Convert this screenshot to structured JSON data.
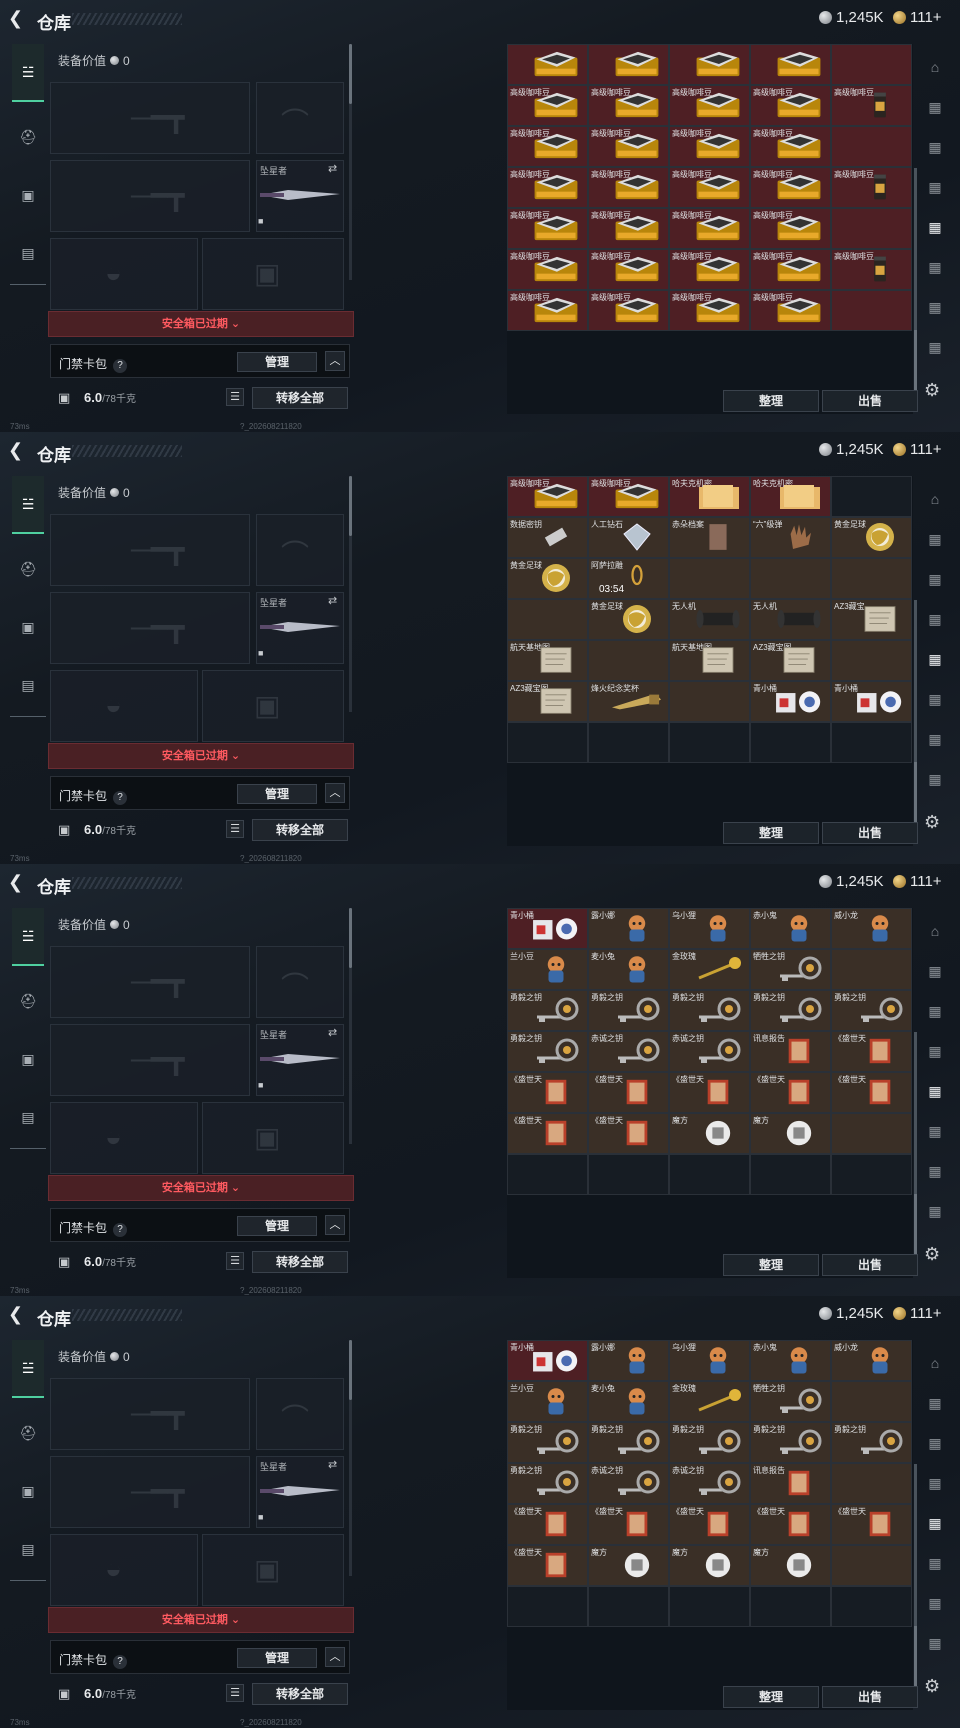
{
  "header": {
    "title": "仓库",
    "silver": "1,245K",
    "gold": "111+"
  },
  "left": {
    "equip_value_label": "装备价值",
    "equip_value": "0",
    "knife_label": "坠星者",
    "warning": "安全箱已过期",
    "keybag_label": "门禁卡包",
    "manage_label": "管理",
    "weight": "6.0",
    "weight_max": "/78千克",
    "move_all_label": "转移全部"
  },
  "buttons": {
    "sort": "整理",
    "sell": "出售"
  },
  "footer": {
    "ping": "73ms",
    "version": "?_202608211820"
  },
  "screens": [
    {
      "cells": [
        {
          "name": "",
          "c": "red",
          "icon": "coffee-bag"
        },
        {
          "name": "",
          "c": "red",
          "icon": "coffee-bag"
        },
        {
          "name": "",
          "c": "red",
          "icon": "coffee-bag"
        },
        {
          "name": "",
          "c": "red",
          "icon": "coffee-bag"
        },
        {
          "name": "",
          "c": "red",
          "icon": "empty"
        },
        {
          "name": "高级咖啡豆",
          "c": "red",
          "icon": "coffee-bag"
        },
        {
          "name": "高级咖啡豆",
          "c": "red",
          "icon": "coffee-bag"
        },
        {
          "name": "高级咖啡豆",
          "c": "red",
          "icon": "coffee-bag"
        },
        {
          "name": "高级咖啡豆",
          "c": "red",
          "icon": "coffee-bag"
        },
        {
          "name": "高级咖啡豆",
          "c": "red",
          "icon": "coffee-tall"
        },
        {
          "name": "高级咖啡豆",
          "c": "red",
          "icon": "coffee-bag"
        },
        {
          "name": "高级咖啡豆",
          "c": "red",
          "icon": "coffee-bag"
        },
        {
          "name": "高级咖啡豆",
          "c": "red",
          "icon": "coffee-bag"
        },
        {
          "name": "高级咖啡豆",
          "c": "red",
          "icon": "coffee-bag"
        },
        {
          "name": "",
          "c": "red",
          "icon": "empty"
        },
        {
          "name": "高级咖啡豆",
          "c": "red",
          "icon": "coffee-bag"
        },
        {
          "name": "高级咖啡豆",
          "c": "red",
          "icon": "coffee-bag"
        },
        {
          "name": "高级咖啡豆",
          "c": "red",
          "icon": "coffee-bag"
        },
        {
          "name": "高级咖啡豆",
          "c": "red",
          "icon": "coffee-bag"
        },
        {
          "name": "高级咖啡豆",
          "c": "red",
          "icon": "coffee-tall"
        },
        {
          "name": "高级咖啡豆",
          "c": "red",
          "icon": "coffee-bag"
        },
        {
          "name": "高级咖啡豆",
          "c": "red",
          "icon": "coffee-bag"
        },
        {
          "name": "高级咖啡豆",
          "c": "red",
          "icon": "coffee-bag"
        },
        {
          "name": "高级咖啡豆",
          "c": "red",
          "icon": "coffee-bag"
        },
        {
          "name": "",
          "c": "red",
          "icon": "empty"
        },
        {
          "name": "高级咖啡豆",
          "c": "red",
          "icon": "coffee-bag"
        },
        {
          "name": "高级咖啡豆",
          "c": "red",
          "icon": "coffee-bag"
        },
        {
          "name": "高级咖啡豆",
          "c": "red",
          "icon": "coffee-bag"
        },
        {
          "name": "高级咖啡豆",
          "c": "red",
          "icon": "coffee-bag"
        },
        {
          "name": "高级咖啡豆",
          "c": "red",
          "icon": "coffee-tall"
        },
        {
          "name": "高级咖啡豆",
          "c": "red",
          "icon": "coffee-bag"
        },
        {
          "name": "高级咖啡豆",
          "c": "red",
          "icon": "coffee-bag"
        },
        {
          "name": "高级咖啡豆",
          "c": "red",
          "icon": "coffee-bag"
        },
        {
          "name": "高级咖啡豆",
          "c": "red",
          "icon": "coffee-bag"
        },
        {
          "name": "",
          "c": "red",
          "icon": "empty"
        }
      ]
    },
    {
      "cells": [
        {
          "name": "高级咖啡豆",
          "c": "red",
          "icon": "coffee-bag"
        },
        {
          "name": "高级咖啡豆",
          "c": "red",
          "icon": "coffee-bag"
        },
        {
          "name": "哈夫克机密",
          "c": "red",
          "icon": "folder"
        },
        {
          "name": "哈夫克机密",
          "c": "red",
          "icon": "folder"
        },
        {
          "name": "",
          "c": "empty",
          "icon": "empty"
        },
        {
          "name": "数据密钥",
          "c": "brown",
          "icon": "chip"
        },
        {
          "name": "人工钻石",
          "c": "brown",
          "icon": "diamond"
        },
        {
          "name": "赤朵档案",
          "c": "brown",
          "icon": "doc"
        },
        {
          "name": "“六”级弹",
          "c": "brown",
          "icon": "hand"
        },
        {
          "name": "黄金足球",
          "c": "brown",
          "icon": "ball"
        },
        {
          "name": "黄金足球",
          "c": "brown",
          "icon": "ball"
        },
        {
          "name": "阿萨拉雕",
          "c": "brown",
          "icon": "statue"
        },
        {
          "name": "",
          "c": "brown",
          "icon": "empty"
        },
        {
          "name": "",
          "c": "brown",
          "icon": "empty"
        },
        {
          "name": "",
          "c": "brown",
          "icon": "empty"
        },
        {
          "name": "",
          "c": "brown",
          "icon": "empty"
        },
        {
          "name": "黄金足球",
          "c": "brown",
          "icon": "ball"
        },
        {
          "name": "无人机",
          "c": "brown",
          "icon": "drum"
        },
        {
          "name": "无人机",
          "c": "brown",
          "icon": "drum"
        },
        {
          "name": "AZ3藏宝",
          "c": "brown",
          "icon": "map"
        },
        {
          "name": "航天基地图",
          "c": "brown",
          "icon": "map"
        },
        {
          "name": "",
          "c": "brown",
          "icon": "empty"
        },
        {
          "name": "航天基地图",
          "c": "brown",
          "icon": "map"
        },
        {
          "name": "AZ3藏宝图",
          "c": "brown",
          "icon": "map"
        },
        {
          "name": "",
          "c": "brown",
          "icon": "empty"
        },
        {
          "name": "AZ3藏宝图",
          "c": "brown",
          "icon": "map"
        },
        {
          "name": "烽火纪念奖杯",
          "c": "brown",
          "icon": "sword"
        },
        {
          "name": "",
          "c": "brown",
          "icon": "empty"
        },
        {
          "name": "青小桶",
          "c": "brown",
          "icon": "robot"
        },
        {
          "name": "青小桶",
          "c": "brown",
          "icon": "robot"
        }
      ],
      "timer": "03:54"
    },
    {
      "cells": [
        {
          "name": "青小桶",
          "c": "red",
          "icon": "robot"
        },
        {
          "name": "露小娜",
          "c": "brown",
          "icon": "doll"
        },
        {
          "name": "乌小狸",
          "c": "brown",
          "icon": "doll"
        },
        {
          "name": "赤小鬼",
          "c": "brown",
          "icon": "doll"
        },
        {
          "name": "威小龙",
          "c": "brown",
          "icon": "doll"
        },
        {
          "name": "兰小豆",
          "c": "brown",
          "icon": "doll"
        },
        {
          "name": "麦小兔",
          "c": "brown",
          "icon": "doll"
        },
        {
          "name": "金玫瑰",
          "c": "brown",
          "icon": "rose"
        },
        {
          "name": "牺牲之钥",
          "c": "brown",
          "icon": "key"
        },
        {
          "name": "",
          "c": "brown",
          "icon": "empty"
        },
        {
          "name": "勇毅之钥",
          "c": "brown",
          "icon": "key"
        },
        {
          "name": "勇毅之钥",
          "c": "brown",
          "icon": "key"
        },
        {
          "name": "勇毅之钥",
          "c": "brown",
          "icon": "key"
        },
        {
          "name": "勇毅之钥",
          "c": "brown",
          "icon": "key"
        },
        {
          "name": "勇毅之钥",
          "c": "brown",
          "icon": "key"
        },
        {
          "name": "勇毅之钥",
          "c": "brown",
          "icon": "key"
        },
        {
          "name": "赤诚之钥",
          "c": "brown",
          "icon": "key"
        },
        {
          "name": "赤诚之钥",
          "c": "brown",
          "icon": "key"
        },
        {
          "name": "讯息报告",
          "c": "brown",
          "icon": "book"
        },
        {
          "name": "《盛世天",
          "c": "brown",
          "icon": "book"
        },
        {
          "name": "《盛世天",
          "c": "brown",
          "icon": "book"
        },
        {
          "name": "《盛世天",
          "c": "brown",
          "icon": "book"
        },
        {
          "name": "《盛世天",
          "c": "brown",
          "icon": "book"
        },
        {
          "name": "《盛世天",
          "c": "brown",
          "icon": "book"
        },
        {
          "name": "《盛世天",
          "c": "brown",
          "icon": "book"
        },
        {
          "name": "《盛世天",
          "c": "brown",
          "icon": "book"
        },
        {
          "name": "《盛世天",
          "c": "brown",
          "icon": "book"
        },
        {
          "name": "魔方",
          "c": "brown",
          "icon": "cube"
        },
        {
          "name": "魔方",
          "c": "brown",
          "icon": "cube"
        },
        {
          "name": "",
          "c": "brown",
          "icon": "empty"
        }
      ]
    },
    {
      "cells": [
        {
          "name": "青小桶",
          "c": "red",
          "icon": "robot"
        },
        {
          "name": "露小娜",
          "c": "brown",
          "icon": "doll"
        },
        {
          "name": "乌小狸",
          "c": "brown",
          "icon": "doll"
        },
        {
          "name": "赤小鬼",
          "c": "brown",
          "icon": "doll"
        },
        {
          "name": "威小龙",
          "c": "brown",
          "icon": "doll"
        },
        {
          "name": "兰小豆",
          "c": "brown",
          "icon": "doll"
        },
        {
          "name": "麦小兔",
          "c": "brown",
          "icon": "doll"
        },
        {
          "name": "金玫瑰",
          "c": "brown",
          "icon": "rose"
        },
        {
          "name": "牺牲之钥",
          "c": "brown",
          "icon": "key"
        },
        {
          "name": "",
          "c": "brown",
          "icon": "empty"
        },
        {
          "name": "勇毅之钥",
          "c": "brown",
          "icon": "key"
        },
        {
          "name": "勇毅之钥",
          "c": "brown",
          "icon": "key"
        },
        {
          "name": "勇毅之钥",
          "c": "brown",
          "icon": "key"
        },
        {
          "name": "勇毅之钥",
          "c": "brown",
          "icon": "key"
        },
        {
          "name": "勇毅之钥",
          "c": "brown",
          "icon": "key"
        },
        {
          "name": "勇毅之钥",
          "c": "brown",
          "icon": "key"
        },
        {
          "name": "赤诚之钥",
          "c": "brown",
          "icon": "key"
        },
        {
          "name": "赤诚之钥",
          "c": "brown",
          "icon": "key"
        },
        {
          "name": "讯息报告",
          "c": "brown",
          "icon": "book"
        },
        {
          "name": "",
          "c": "brown",
          "icon": "empty"
        },
        {
          "name": "《盛世天",
          "c": "brown",
          "icon": "book"
        },
        {
          "name": "《盛世天",
          "c": "brown",
          "icon": "book"
        },
        {
          "name": "《盛世天",
          "c": "brown",
          "icon": "book"
        },
        {
          "name": "《盛世天",
          "c": "brown",
          "icon": "book"
        },
        {
          "name": "《盛世天",
          "c": "brown",
          "icon": "book"
        },
        {
          "name": "《盛世天",
          "c": "brown",
          "icon": "book"
        },
        {
          "name": "魔方",
          "c": "brown",
          "icon": "cube"
        },
        {
          "name": "魔方",
          "c": "brown",
          "icon": "cube"
        },
        {
          "name": "魔方",
          "c": "brown",
          "icon": "cube"
        },
        {
          "name": "",
          "c": "brown",
          "icon": "empty"
        }
      ]
    }
  ]
}
